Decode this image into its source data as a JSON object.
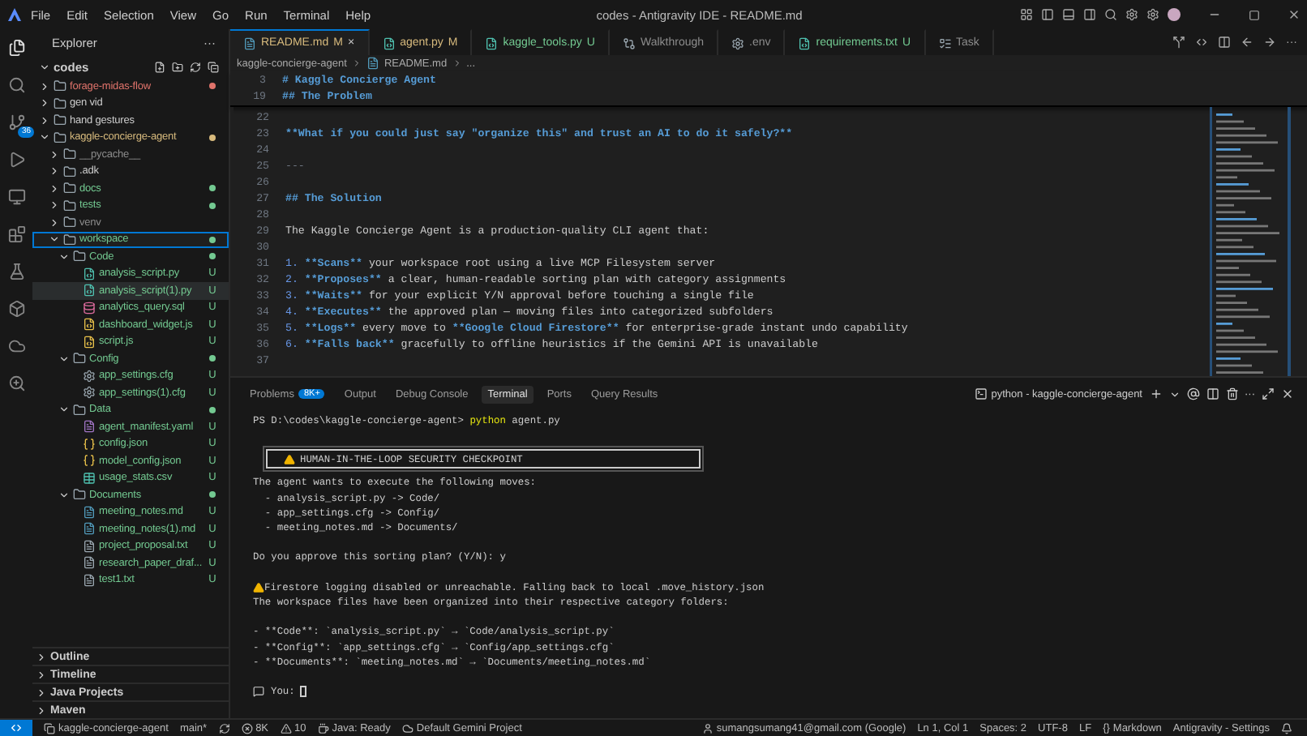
{
  "menu": [
    "File",
    "Edit",
    "Selection",
    "View",
    "Go",
    "Run",
    "Terminal",
    "Help"
  ],
  "window": {
    "title": "codes - Antigravity IDE - README.md"
  },
  "activity_bar": [
    {
      "kind": "files",
      "selected": true
    },
    {
      "kind": "search",
      "selected": false
    },
    {
      "kind": "source-control",
      "selected": false,
      "badge": "36"
    },
    {
      "kind": "run",
      "selected": false
    },
    {
      "kind": "remote",
      "selected": false
    },
    {
      "kind": "extensions",
      "selected": false
    },
    {
      "kind": "testing",
      "selected": false
    },
    {
      "kind": "package",
      "selected": false
    },
    {
      "kind": "cloud",
      "selected": false
    },
    {
      "kind": "zoom",
      "selected": false
    }
  ],
  "sidebar": {
    "title": "Explorer",
    "more": "···",
    "root": "codes",
    "tree": [
      {
        "label": "forage-midas-flow",
        "kind": "folder",
        "expanded": false,
        "selected": false,
        "color": "#e0736b",
        "dot": true
      },
      {
        "label": "gen vid",
        "kind": "folder",
        "expanded": false,
        "selected": false,
        "color": "#cccccc"
      },
      {
        "label": "hand gestures",
        "kind": "folder",
        "expanded": false,
        "selected": false,
        "color": "#cccccc"
      },
      {
        "label": "kaggle-concierge-agent",
        "kind": "folder",
        "expanded": true,
        "selected": false,
        "color": "#d7ba7d",
        "dot": true,
        "children": [
          {
            "label": "__pycache__",
            "kind": "folder",
            "expanded": false,
            "selected": false,
            "color": "#8c8c8c"
          },
          {
            "label": ".adk",
            "kind": "folder",
            "expanded": false,
            "selected": false,
            "color": "#cccccc"
          },
          {
            "label": "docs",
            "kind": "folder",
            "expanded": false,
            "selected": false,
            "color": "#73c991",
            "dot": true
          },
          {
            "label": "tests",
            "kind": "folder",
            "expanded": false,
            "selected": false,
            "color": "#73c991",
            "dot": true
          },
          {
            "label": "venv",
            "kind": "folder",
            "expanded": false,
            "selected": false,
            "color": "#8c8c8c"
          },
          {
            "label": "workspace",
            "kind": "folder",
            "expanded": true,
            "selected": true,
            "color": "#73c991",
            "dot": true,
            "children": [
              {
                "label": "Code",
                "kind": "folder",
                "expanded": true,
                "selected": false,
                "color": "#73c991",
                "dot": true,
                "children": [
                  {
                    "label": "analysis_script.py",
                    "kind": "python",
                    "selected": false,
                    "color": "#73c991",
                    "badge": "U"
                  },
                  {
                    "label": "analysis_script(1).py",
                    "kind": "python",
                    "selected": false,
                    "color": "#73c991",
                    "badge": "U",
                    "hovered": true
                  },
                  {
                    "label": "analytics_query.sql",
                    "kind": "sql",
                    "selected": false,
                    "color": "#73c991",
                    "badge": "U"
                  },
                  {
                    "label": "dashboard_widget.js",
                    "kind": "js",
                    "selected": false,
                    "color": "#73c991",
                    "badge": "U"
                  },
                  {
                    "label": "script.js",
                    "kind": "js",
                    "selected": false,
                    "color": "#73c991",
                    "badge": "U"
                  }
                ]
              },
              {
                "label": "Config",
                "kind": "folder",
                "expanded": true,
                "selected": false,
                "color": "#73c991",
                "dot": true,
                "children": [
                  {
                    "label": "app_settings.cfg",
                    "kind": "gear",
                    "selected": false,
                    "color": "#73c991",
                    "badge": "U"
                  },
                  {
                    "label": "app_settings(1).cfg",
                    "kind": "gear",
                    "selected": false,
                    "color": "#73c991",
                    "badge": "U"
                  }
                ]
              },
              {
                "label": "Data",
                "kind": "folder",
                "expanded": true,
                "selected": false,
                "color": "#73c991",
                "dot": true,
                "children": [
                  {
                    "label": "agent_manifest.yaml",
                    "kind": "yaml",
                    "selected": false,
                    "color": "#73c991",
                    "badge": "U"
                  },
                  {
                    "label": "config.json",
                    "kind": "json",
                    "selected": false,
                    "color": "#73c991",
                    "badge": "U"
                  },
                  {
                    "label": "model_config.json",
                    "kind": "json",
                    "selected": false,
                    "color": "#73c991",
                    "badge": "U"
                  },
                  {
                    "label": "usage_stats.csv",
                    "kind": "csv",
                    "selected": false,
                    "color": "#73c991",
                    "badge": "U"
                  }
                ]
              },
              {
                "label": "Documents",
                "kind": "folder",
                "expanded": true,
                "selected": false,
                "color": "#73c991",
                "dot": true,
                "children": [
                  {
                    "label": "meeting_notes.md",
                    "kind": "md",
                    "selected": false,
                    "color": "#73c991",
                    "badge": "U"
                  },
                  {
                    "label": "meeting_notes(1).md",
                    "kind": "md",
                    "selected": false,
                    "color": "#73c991",
                    "badge": "U"
                  },
                  {
                    "label": "project_proposal.txt",
                    "kind": "txt",
                    "selected": false,
                    "color": "#73c991",
                    "badge": "U"
                  },
                  {
                    "label": "research_paper_draf...",
                    "kind": "txt",
                    "selected": false,
                    "color": "#73c991",
                    "badge": "U"
                  },
                  {
                    "label": "test1.txt",
                    "kind": "txt",
                    "selected": false,
                    "color": "#73c991",
                    "badge": "U"
                  }
                ]
              }
            ]
          }
        ]
      }
    ],
    "sections": [
      "Outline",
      "Timeline",
      "Java Projects",
      "Maven"
    ]
  },
  "tabs": [
    {
      "label": "README.md",
      "status": "M",
      "kind": "md",
      "selected": true,
      "close": "×",
      "color": "#d7ba7d"
    },
    {
      "label": "agent.py",
      "status": "M",
      "kind": "python",
      "selected": false,
      "color": "#d7ba7d"
    },
    {
      "label": "kaggle_tools.py",
      "status": "U",
      "kind": "python",
      "selected": false,
      "color": "#73c991"
    },
    {
      "label": "Walkthrough",
      "kind": "diff",
      "selected": false,
      "color": "#8c8c8c"
    },
    {
      "label": ".env",
      "kind": "gear",
      "selected": false,
      "color": "#8c8c8c"
    },
    {
      "label": "requirements.txt",
      "status": "U",
      "kind": "python",
      "selected": false,
      "color": "#73c991"
    },
    {
      "label": "Task",
      "kind": "list",
      "selected": false,
      "color": "#8c8c8c"
    }
  ],
  "tab_actions": [
    "···"
  ],
  "breadcrumb": [
    "kaggle-concierge-agent",
    "README.md",
    "..."
  ],
  "sticky_lines": [
    {
      "number": "3",
      "segments": [
        {
          "text": "# Kaggle Concierge Agent",
          "kind": "heading"
        }
      ]
    },
    {
      "number": "19",
      "segments": [
        {
          "text": "## The Problem",
          "kind": "heading"
        }
      ]
    }
  ],
  "lines": [
    {
      "number": "22"
    },
    {
      "number": "23",
      "segments": [
        {
          "text": "**What if you could just say \"organize this\" and trust an AI to do it safely?**",
          "kind": "bold"
        }
      ]
    },
    {
      "number": "24"
    },
    {
      "number": "25",
      "segments": [
        {
          "text": "---",
          "kind": "rule"
        }
      ]
    },
    {
      "number": "26"
    },
    {
      "number": "27",
      "segments": [
        {
          "text": "## The Solution",
          "kind": "heading"
        }
      ]
    },
    {
      "number": "28"
    },
    {
      "number": "29",
      "segments": [
        {
          "text": "The Kaggle Concierge Agent is a production-quality CLI agent that:",
          "kind": "plain"
        }
      ]
    },
    {
      "number": "30"
    },
    {
      "number": "31",
      "segments": [
        {
          "text": "1. ",
          "kind": "marker"
        },
        {
          "text": "**Scans**",
          "kind": "bold"
        },
        {
          "text": " your workspace root using a live MCP Filesystem server",
          "kind": "plain"
        }
      ]
    },
    {
      "number": "32",
      "segments": [
        {
          "text": "2. ",
          "kind": "marker"
        },
        {
          "text": "**Proposes**",
          "kind": "bold"
        },
        {
          "text": " a clear, human-readable sorting plan with category assignments",
          "kind": "plain"
        }
      ]
    },
    {
      "number": "33",
      "segments": [
        {
          "text": "3. ",
          "kind": "marker"
        },
        {
          "text": "**Waits**",
          "kind": "bold"
        },
        {
          "text": " for your explicit Y/N approval before touching a single file",
          "kind": "plain"
        }
      ]
    },
    {
      "number": "34",
      "segments": [
        {
          "text": "4. ",
          "kind": "marker"
        },
        {
          "text": "**Executes**",
          "kind": "bold"
        },
        {
          "text": " the approved plan — moving files into categorized subfolders",
          "kind": "plain"
        }
      ]
    },
    {
      "number": "35",
      "segments": [
        {
          "text": "5. ",
          "kind": "marker"
        },
        {
          "text": "**Logs**",
          "kind": "bold"
        },
        {
          "text": " every move to ",
          "kind": "plain"
        },
        {
          "text": "**Google Cloud Firestore**",
          "kind": "bold"
        },
        {
          "text": " for enterprise-grade instant undo capability",
          "kind": "plain"
        }
      ]
    },
    {
      "number": "36",
      "segments": [
        {
          "text": "6. ",
          "kind": "marker"
        },
        {
          "text": "**Falls back**",
          "kind": "bold"
        },
        {
          "text": " gracefully to offline heuristics if the Gemini API is unavailable",
          "kind": "plain"
        }
      ]
    },
    {
      "number": "37"
    }
  ],
  "panel": {
    "tabs": [
      {
        "label": "Problems",
        "badge": "8K+",
        "selected": false
      },
      {
        "label": "Output",
        "selected": false
      },
      {
        "label": "Debug Console",
        "selected": false
      },
      {
        "label": "Terminal",
        "selected": true
      },
      {
        "label": "Ports",
        "selected": false
      },
      {
        "label": "Query Results",
        "selected": false
      }
    ],
    "terminal_name": "python - kaggle-concierge-agent",
    "more": "···",
    "terminal": [
      {
        "kind": "prompt",
        "prompt": "PS D:\\codes\\kaggle-concierge-agent>",
        "command": "python",
        "args": " agent.py"
      },
      {
        "kind": "blank"
      },
      {
        "kind": "banner",
        "text": "HUMAN-IN-THE-LOOP SECURITY CHECKPOINT"
      },
      {
        "kind": "text",
        "text": "The agent wants to execute the following moves:"
      },
      {
        "kind": "text",
        "text": "  - analysis_script.py -> Code/"
      },
      {
        "kind": "text",
        "text": "  - app_settings.cfg -> Config/"
      },
      {
        "kind": "text",
        "text": "  - meeting_notes.md -> Documents/"
      },
      {
        "kind": "blank"
      },
      {
        "kind": "text",
        "text": "Do you approve this sorting plan? (Y/N): y"
      },
      {
        "kind": "blank"
      },
      {
        "kind": "warning",
        "text": "Firestore logging disabled or unreachable. Falling back to local .move_history.json"
      },
      {
        "kind": "text",
        "text": "The workspace files have been organized into their respective category folders:"
      },
      {
        "kind": "blank"
      },
      {
        "kind": "text",
        "text": "- **Code**: `analysis_script.py` → `Code/analysis_script.py`"
      },
      {
        "kind": "text",
        "text": "- **Config**: `app_settings.cfg` → `Config/app_settings.cfg`"
      },
      {
        "kind": "text",
        "text": "- **Documents**: `meeting_notes.md` → `Documents/meeting_notes.md`"
      },
      {
        "kind": "blank"
      },
      {
        "kind": "input",
        "text": "You:"
      }
    ]
  },
  "status_bar": {
    "left": [
      {
        "kind": "branch-repo",
        "label": "kaggle-concierge-agent"
      },
      {
        "kind": "plain",
        "label": "main*"
      },
      {
        "kind": "sync"
      },
      {
        "kind": "errors",
        "label": "8K"
      },
      {
        "kind": "warnings",
        "label": "10"
      },
      {
        "kind": "java",
        "label": "Java: Ready"
      },
      {
        "kind": "cloud",
        "label": "Default Gemini Project"
      }
    ],
    "right": [
      {
        "kind": "account",
        "label": "sumangsumang41@gmail.com (Google)"
      },
      {
        "kind": "plain",
        "label": "Ln 1, Col 1"
      },
      {
        "kind": "plain",
        "label": "Spaces: 2"
      },
      {
        "kind": "plain",
        "label": "UTF-8"
      },
      {
        "kind": "plain",
        "label": "LF"
      },
      {
        "kind": "braces",
        "icon": "{}",
        "label": "Markdown"
      },
      {
        "kind": "plain",
        "label": "Antigravity - Settings"
      },
      {
        "kind": "bell"
      }
    ]
  }
}
